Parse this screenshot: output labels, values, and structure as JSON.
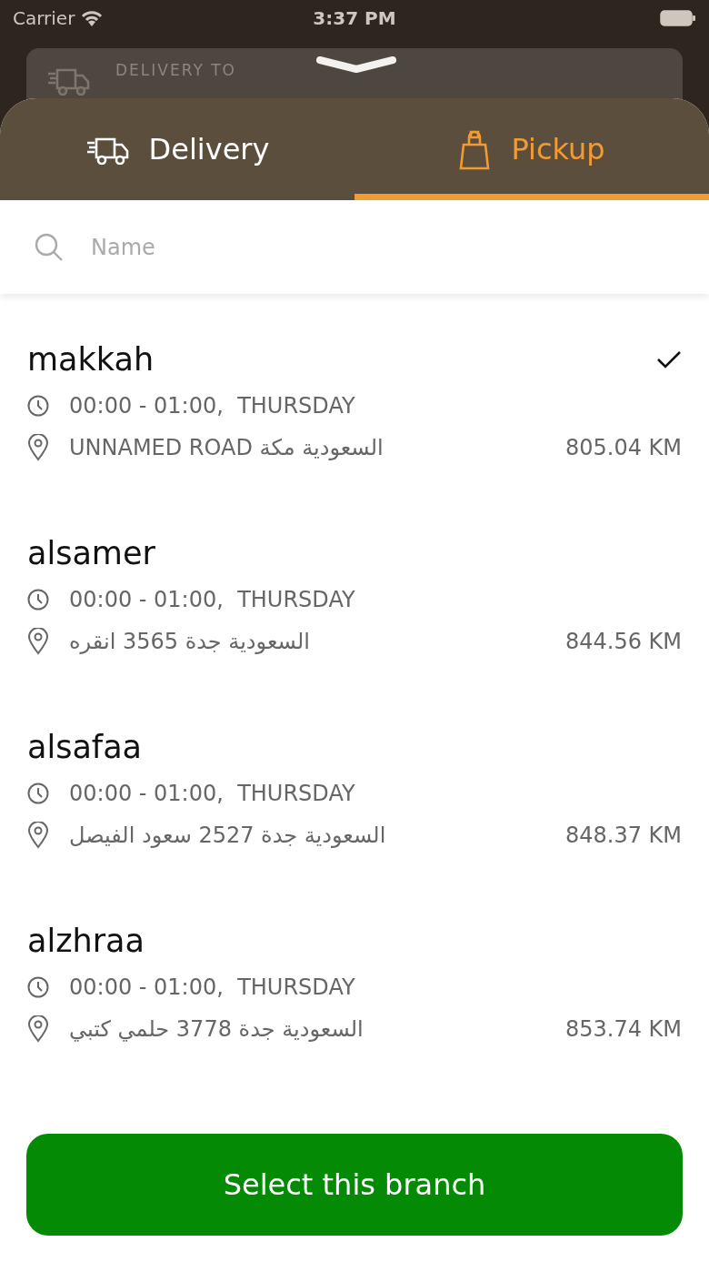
{
  "status_bar": {
    "carrier": "Carrier",
    "time": "3:37 PM"
  },
  "background": {
    "label": "DELIVERY TO"
  },
  "tabs": [
    {
      "label": "Delivery",
      "kind": "delivery",
      "selected": false
    },
    {
      "label": "Pickup",
      "kind": "pickup",
      "selected": true
    }
  ],
  "search": {
    "placeholder": "Name"
  },
  "branches": [
    {
      "name": "makkah",
      "hours": "00:00 - 01:00,  THURSDAY",
      "address": "UNNAMED ROAD السعودية مكة",
      "distance": "805.04 KM",
      "selected": true
    },
    {
      "name": "alsamer",
      "hours": "00:00 - 01:00,  THURSDAY",
      "address": "السعودية جدة 3565 انقره",
      "distance": "844.56 KM",
      "selected": false
    },
    {
      "name": "alsafaa",
      "hours": "00:00 - 01:00,  THURSDAY",
      "address": "السعودية جدة 2527 سعود الفيصل",
      "distance": "848.37 KM",
      "selected": false
    },
    {
      "name": "alzhraa",
      "hours": "00:00 - 01:00,  THURSDAY",
      "address": "السعودية جدة 3778 حلمي كتبي",
      "distance": "853.74 KM",
      "selected": false
    }
  ],
  "button": {
    "label": "Select this branch"
  }
}
